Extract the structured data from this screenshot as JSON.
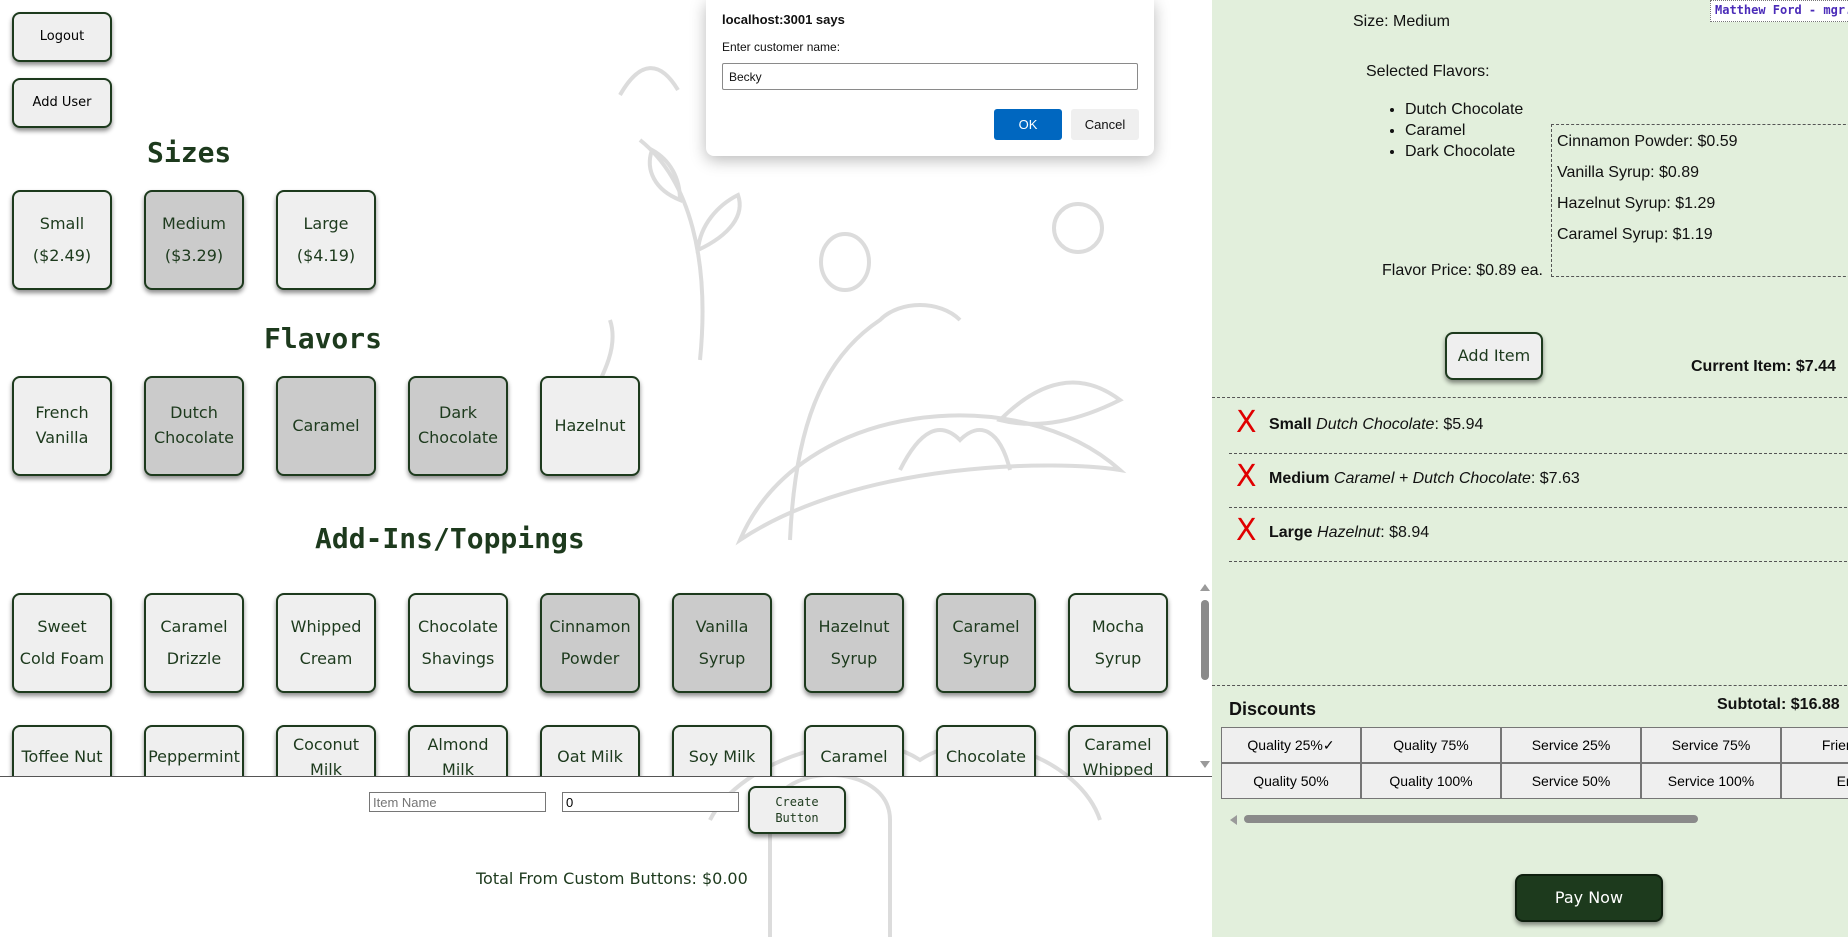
{
  "top_buttons": {
    "logout": "Logout",
    "add_user": "Add User"
  },
  "sizes": {
    "heading": "Sizes",
    "items": [
      {
        "name": "Small",
        "price": "($2.49)",
        "selected": false
      },
      {
        "name": "Medium",
        "price": "($3.29)",
        "selected": true
      },
      {
        "name": "Large",
        "price": "($4.19)",
        "selected": false
      }
    ]
  },
  "flavors": {
    "heading": "Flavors",
    "items": [
      {
        "name": "French Vanilla",
        "selected": false
      },
      {
        "name": "Dutch Chocolate",
        "selected": true
      },
      {
        "name": "Caramel",
        "selected": true
      },
      {
        "name": "Dark Chocolate",
        "selected": true
      },
      {
        "name": "Hazelnut",
        "selected": false
      }
    ]
  },
  "addins": {
    "heading": "Add-Ins/Toppings",
    "row1": [
      {
        "name": "Sweet Cold Foam",
        "selected": false
      },
      {
        "name": "Caramel Drizzle",
        "selected": false
      },
      {
        "name": "Whipped Cream",
        "selected": false
      },
      {
        "name": "Chocolate Shavings",
        "selected": false
      },
      {
        "name": "Cinnamon Powder",
        "selected": true
      },
      {
        "name": "Vanilla Syrup",
        "selected": true
      },
      {
        "name": "Hazelnut Syrup",
        "selected": true
      },
      {
        "name": "Caramel Syrup",
        "selected": true
      },
      {
        "name": "Mocha Syrup",
        "selected": false
      }
    ],
    "row2": [
      "Toffee Nut",
      "Peppermint",
      "Coconut Milk",
      "Almond Milk",
      "Oat Milk",
      "Soy Milk",
      "Caramel",
      "Chocolate",
      "Caramel Whipped"
    ]
  },
  "custom": {
    "item_name_placeholder": "Item Name",
    "price_value": "0",
    "create_button": "Create Button",
    "total": "Total From Custom Buttons: $0.00"
  },
  "user": "Matthew Ford - mgr.",
  "current_item": {
    "size": "Size: Medium",
    "flavors_label": "Selected Flavors:",
    "flavors": [
      "Dutch Chocolate",
      "Caramel",
      "Dark Chocolate"
    ],
    "flavor_price": "Flavor Price: $0.89 ea.",
    "addins": [
      "Cinnamon Powder: $0.59",
      "Vanilla Syrup: $0.89",
      "Hazelnut Syrup: $1.29",
      "Caramel Syrup: $1.19"
    ],
    "add_button": "Add Item",
    "total": "Current Item: $7.44"
  },
  "order_items": [
    {
      "size": "Small",
      "desc": "Dutch Chocolate",
      "price": ": $5.94"
    },
    {
      "size": "Medium",
      "desc": "Caramel + Dutch Chocolate",
      "price": ": $7.63"
    },
    {
      "size": "Large",
      "desc": "Hazelnut",
      "price": ": $8.94"
    }
  ],
  "remove_mark": "X",
  "discounts": {
    "heading": "Discounts",
    "subtotal": "Subtotal: $16.88",
    "row1": [
      "Quality 25%✓",
      "Quality 75%",
      "Service 25%",
      "Service 75%",
      "Friends a"
    ],
    "row2": [
      "Quality 50%",
      "Quality 100%",
      "Service 50%",
      "Service 100%",
      "Emp"
    ]
  },
  "pay_button": "Pay Now",
  "dialog": {
    "title": "localhost:3001 says",
    "message": "Enter customer name:",
    "input_value": "Becky",
    "ok": "OK",
    "cancel": "Cancel"
  },
  "colors": {
    "accent": "#1d3a1d",
    "selected": "#cbcbcb",
    "panel": "#e2efdc",
    "remove": "#e00000",
    "dialog_ok": "#0067c0"
  }
}
